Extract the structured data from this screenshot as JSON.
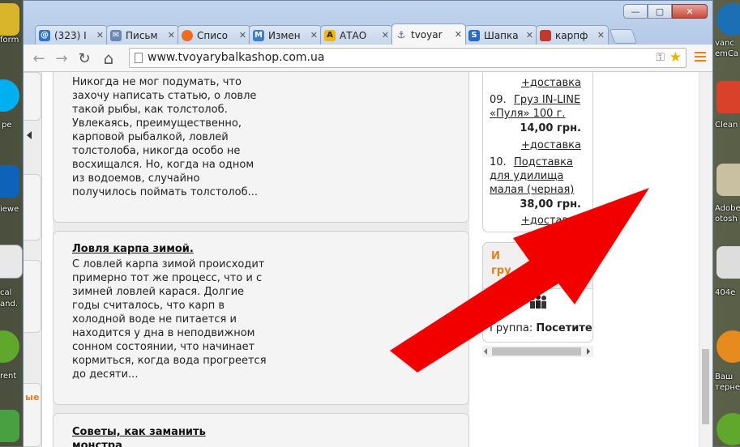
{
  "desktop": {
    "left_labels": [
      "form",
      "pe",
      "iewe",
      "cal",
      "and.",
      "rent"
    ],
    "right_labels": [
      "vanc",
      "emCa",
      "Clean",
      "Adobe",
      "otosh",
      "404e",
      "Ваш",
      "терне"
    ]
  },
  "window": {
    "controls": {
      "minimize": "—",
      "maximize": "▢",
      "close": "✕"
    }
  },
  "tabs": [
    {
      "icon": "@",
      "icon_color": "#2e76c4",
      "title": "(323) I"
    },
    {
      "icon": "✉",
      "icon_color": "#6b86b8",
      "title": "Письм"
    },
    {
      "icon": "●",
      "icon_color": "#f06a23",
      "title": "Списо"
    },
    {
      "icon": "М",
      "icon_color": "#3b7fc4",
      "title": "Измен"
    },
    {
      "icon": "A",
      "icon_color": "#f2b900",
      "title": "АТАО"
    },
    {
      "icon": "⚓",
      "icon_color": "#4a5a7a",
      "title": "tvoyar",
      "active": true
    },
    {
      "icon": "S",
      "icon_color": "#2769c8",
      "title": "Шапка"
    },
    {
      "icon": "▣",
      "icon_color": "#c0392b",
      "title": "карпф"
    }
  ],
  "toolbar": {
    "back": "←",
    "forward": "→",
    "reload": "↻",
    "home": "⌂",
    "url": "www.tvoyarybalkashop.com.ua",
    "key": "🔑",
    "star": "☆"
  },
  "articles": [
    {
      "title": "",
      "body": "Никогда не мог подумать, что захочу написать статью, о ловле такой рыбы, как толстолоб. Увлекаясь, преимущественно, карповой рыбалкой, ловлей толстолоба, никогда особо не восхищался. Но, когда на одном из водоемов, случайно получилось поймать толстолоб..."
    },
    {
      "title": "Ловля карпа зимой.",
      "body": "С ловлей карпа зимой происходит примерно тот же процесс, что и с зимней ловлей карася. Долгие годы считалось, что карп в холодной воде не питается и находится у дна в неподвижном сонном состоянии, что начинает кормиться, когда вода прогреется до десяти..."
    },
    {
      "title": "Советы, как заманить монстра",
      "body": ""
    }
  ],
  "goods": {
    "delivery_1": "+доставка",
    "item9_num": "09.",
    "item9_name_1": "Груз IN-LINE",
    "item9_name_2": "«Пуля» 100 г.",
    "item9_price": "14,00 грн.",
    "delivery_2": "+доставка",
    "item10_num": "10.",
    "item10_name_1": "Подставка",
    "item10_name_2": "для удилища",
    "item10_name_3": "малая (черная)",
    "item10_price": "38,00 грн.",
    "delivery_3": "+доставка"
  },
  "users_box": {
    "head_line1": "И",
    "head_line2": "гру",
    "group_label": "Группа:",
    "group_value": "Посетител"
  },
  "left_orange": "ые",
  "colors": {
    "accent_orange": "#e57e1c",
    "arrow_red": "#f20000"
  }
}
